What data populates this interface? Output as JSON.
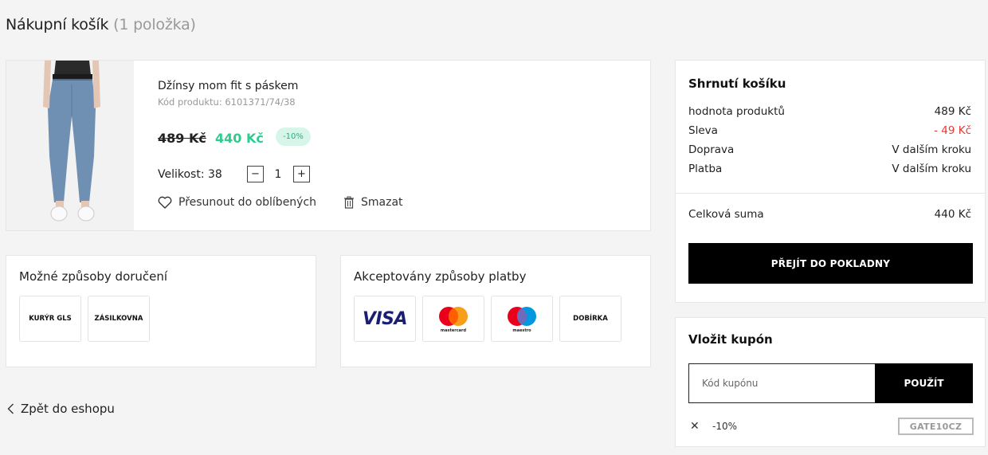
{
  "header": {
    "title": "Nákupní košík",
    "count": "(1 položka)"
  },
  "product": {
    "name": "Džínsy mom fit s páskem",
    "code": "Kód produktu: 6101371/74/38",
    "old_price": "489 Kč",
    "new_price": "440 Kč",
    "discount": "-10%",
    "size_label": "Velikost: 38",
    "quantity": "1",
    "qty_minus": "−",
    "qty_plus": "+",
    "move_to_favorites": "Přesunout do oblíbených",
    "delete": "Smazat"
  },
  "delivery": {
    "title": "Možné způsoby doručení",
    "options": [
      "KURÝR GLS",
      "ZÁSILKOVNA"
    ]
  },
  "payment": {
    "title": "Akceptovány způsoby platby",
    "methods": [
      "VISA",
      "mastercard",
      "maestro",
      "DOBÍRKA"
    ]
  },
  "back_link": "Zpět do eshopu",
  "summary": {
    "title": "Shrnutí košíku",
    "rows": [
      {
        "label": "hodnota produktů",
        "value": "489 Kč"
      },
      {
        "label": "Sleva",
        "value": "- 49 Kč"
      },
      {
        "label": "Doprava",
        "value": "V dalším kroku"
      },
      {
        "label": "Platba",
        "value": "V dalším kroku"
      }
    ],
    "total_label": "Celková suma",
    "total_value": "440 Kč",
    "checkout_button": "PŘEJÍT DO POKLADNY"
  },
  "coupon": {
    "title": "Vložit kupón",
    "placeholder": "Kód kupónu",
    "apply_button": "POUŽÍT",
    "applied_discount": "-10%",
    "applied_code": "GATE10CZ",
    "remove_symbol": "✕"
  },
  "colors": {
    "accent_green": "#2dcc8f",
    "discount_red": "#e53935",
    "primary_black": "#000000"
  }
}
